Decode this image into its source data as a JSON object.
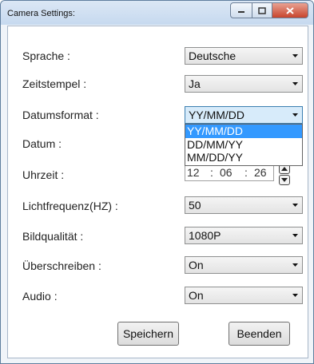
{
  "window": {
    "title": "Camera Settings:"
  },
  "fields": {
    "sprache": {
      "label": "Sprache :",
      "value": "Deutsche"
    },
    "zeitstempel": {
      "label": "Zeitstempel :",
      "value": "Ja"
    },
    "datumsformat": {
      "label": "Datumsformat :",
      "value": "YY/MM/DD",
      "options": [
        "YY/MM/DD",
        "DD/MM/YY",
        "MM/DD/YY"
      ]
    },
    "datum": {
      "label": "Datum :"
    },
    "uhrzeit": {
      "label": "Uhrzeit :",
      "hour": "12",
      "minute": "06",
      "second": "26",
      "sep": ":"
    },
    "lichtfrequenz": {
      "label": "Lichtfrequenz(HZ) :",
      "value": "50"
    },
    "bildqualitaet": {
      "label": "Bildqualität :",
      "value": "1080P"
    },
    "ueberschreiben": {
      "label": "Überschreiben :",
      "value": "On"
    },
    "audio": {
      "label": "Audio :",
      "value": "On"
    }
  },
  "buttons": {
    "save": "Speichern",
    "quit": "Beenden"
  },
  "colors": {
    "selection": "#3399ff",
    "titlebar": "#c6d9ef",
    "close": "#c7452d"
  },
  "icons": [
    "minimize-icon",
    "maximize-icon",
    "close-icon",
    "chevron-down-icon",
    "spin-up-icon",
    "spin-down-icon"
  ]
}
